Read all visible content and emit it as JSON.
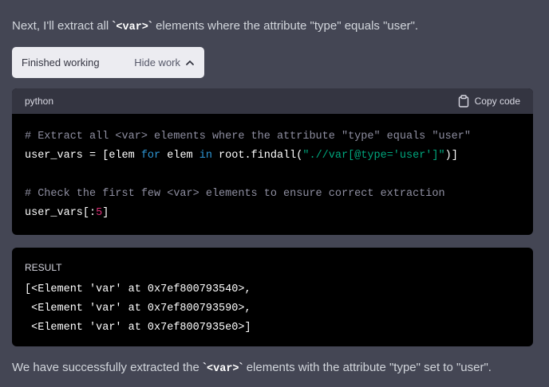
{
  "message": {
    "intro_before": "Next, I'll extract all ",
    "intro_code": "<var>",
    "intro_after": " elements where the attribute \"type\" equals \"user\".",
    "outro_before": "We have successfully extracted the ",
    "outro_code": "<var>",
    "outro_after": " elements with the attribute \"type\" set to \"user\"."
  },
  "work_toggle": {
    "status": "Finished working",
    "hide_label": "Hide work",
    "icon": "chevron-up-icon"
  },
  "code_block": {
    "language": "python",
    "copy_label": "Copy code",
    "copy_icon": "clipboard-icon",
    "line1_comment": "# Extract all <var> elements where the attribute \"type\" equals \"user\"",
    "line2_var": "user_vars = [elem ",
    "line2_kw_for": "for",
    "line2_mid": " elem ",
    "line2_kw_in": "in",
    "line2_call": " root.findall(",
    "line2_str": "\".//var[@type='user']\"",
    "line2_end": ")]",
    "line4_comment": "# Check the first few <var> elements to ensure correct extraction",
    "line5_start": "user_vars[:",
    "line5_num": "5",
    "line5_end": "]"
  },
  "result": {
    "label": "RESULT",
    "lines": [
      "[<Element 'var' at 0x7ef800793540>,",
      " <Element 'var' at 0x7ef800793590>,",
      " <Element 'var' at 0x7ef8007935e0>]"
    ]
  },
  "colors": {
    "background": "#444654",
    "code_bg": "#000000",
    "code_header_bg": "#343541",
    "keyword": "#2e95d3",
    "string": "#00a67d",
    "number": "#df3079",
    "comment": "#8e8ea0"
  }
}
